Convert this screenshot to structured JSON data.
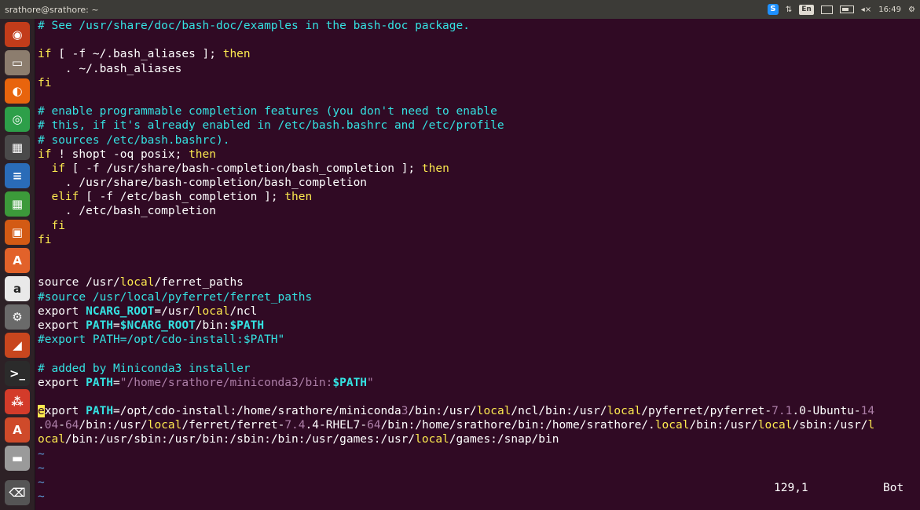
{
  "window": {
    "title": "srathore@srathore: ~"
  },
  "tray": {
    "skype": "S",
    "network": "⇅",
    "keyboard": "En",
    "volume": "◂×",
    "clock": "16:49",
    "settings": "⚙"
  },
  "launcher": [
    {
      "name": "ubuntu-dash-icon",
      "glyph": "◉",
      "bg": "#c23c1a"
    },
    {
      "name": "files-icon",
      "glyph": "▭",
      "bg": "#8c7d6e"
    },
    {
      "name": "firefox-icon",
      "glyph": "◐",
      "bg": "#e8640d"
    },
    {
      "name": "chrome-icon",
      "glyph": "◎",
      "bg": "#2d9f49"
    },
    {
      "name": "calculator-icon",
      "glyph": "▦",
      "bg": "#4a4a4a"
    },
    {
      "name": "libreoffice-writer-icon",
      "glyph": "≡",
      "bg": "#2a6cb8"
    },
    {
      "name": "libreoffice-calc-icon",
      "glyph": "▦",
      "bg": "#3c9a3a"
    },
    {
      "name": "libreoffice-impress-icon",
      "glyph": "▣",
      "bg": "#d35a14"
    },
    {
      "name": "software-center-icon",
      "glyph": "A",
      "bg": "#e2622a"
    },
    {
      "name": "amazon-icon",
      "glyph": "a",
      "bg": "#e9e9e9"
    },
    {
      "name": "system-settings-icon",
      "glyph": "⚙",
      "bg": "#6a6a6a"
    },
    {
      "name": "matlab-icon",
      "glyph": "◢",
      "bg": "#c8461e"
    },
    {
      "name": "terminal-icon",
      "glyph": ">_",
      "bg": "#2b2b2b"
    },
    {
      "name": "ubuntu-one-icon",
      "glyph": "⁂",
      "bg": "#d33b2a"
    },
    {
      "name": "software-updater-icon",
      "glyph": "A",
      "bg": "#cf4a2a"
    },
    {
      "name": "drive-icon",
      "glyph": "▬",
      "bg": "#9a9a9a"
    }
  ],
  "trash": {
    "glyph": "🗑",
    "bg": "#555"
  },
  "status": {
    "position": "129,1",
    "scroll": "Bot"
  },
  "lines": [
    [
      [
        "c",
        "# See /usr/share/doc/bash-doc/examples in the bash-doc package."
      ]
    ],
    [
      [
        "n",
        ""
      ]
    ],
    [
      [
        "k",
        "if"
      ],
      [
        "n",
        " [ -f ~/.bash_aliases ]; "
      ],
      [
        "k",
        "then"
      ]
    ],
    [
      [
        "n",
        "    . ~/.bash_aliases"
      ]
    ],
    [
      [
        "k",
        "fi"
      ]
    ],
    [
      [
        "n",
        ""
      ]
    ],
    [
      [
        "c",
        "# enable programmable completion features (you don't need to enable"
      ]
    ],
    [
      [
        "c",
        "# this, if it's already enabled in /etc/bash.bashrc and /etc/profile"
      ]
    ],
    [
      [
        "c",
        "# sources /etc/bash.bashrc)."
      ]
    ],
    [
      [
        "k",
        "if"
      ],
      [
        "n",
        " ! shopt -oq posix; "
      ],
      [
        "k",
        "then"
      ]
    ],
    [
      [
        "n",
        "  "
      ],
      [
        "k",
        "if"
      ],
      [
        "n",
        " [ -f /usr/share/bash-completion/bash_completion ]; "
      ],
      [
        "k",
        "then"
      ]
    ],
    [
      [
        "n",
        "    . /usr/share/bash-completion/bash_completion"
      ]
    ],
    [
      [
        "n",
        "  "
      ],
      [
        "k",
        "elif"
      ],
      [
        "n",
        " [ -f /etc/bash_completion ]; "
      ],
      [
        "k",
        "then"
      ]
    ],
    [
      [
        "n",
        "    . /etc/bash_completion"
      ]
    ],
    [
      [
        "n",
        "  "
      ],
      [
        "k",
        "fi"
      ]
    ],
    [
      [
        "k",
        "fi"
      ]
    ],
    [
      [
        "n",
        ""
      ]
    ],
    [
      [
        "n",
        ""
      ]
    ],
    [
      [
        "n",
        "source /usr/"
      ],
      [
        "l",
        "local"
      ],
      [
        "n",
        "/ferret_paths"
      ]
    ],
    [
      [
        "c",
        "#source /usr/local/pyferret/ferret_paths"
      ]
    ],
    [
      [
        "n",
        "export "
      ],
      [
        "v",
        "NCARG_ROOT"
      ],
      [
        "n",
        "="
      ],
      [
        "n",
        "/usr/"
      ],
      [
        "l",
        "local"
      ],
      [
        "n",
        "/ncl"
      ]
    ],
    [
      [
        "n",
        "export "
      ],
      [
        "v",
        "PATH"
      ],
      [
        "n",
        "="
      ],
      [
        "v",
        "$NCARG_ROOT"
      ],
      [
        "n",
        "/bin:"
      ],
      [
        "v",
        "$PATH"
      ]
    ],
    [
      [
        "c",
        "#export PATH=/opt/cdo-install:$PATH\""
      ]
    ],
    [
      [
        "n",
        ""
      ]
    ],
    [
      [
        "c",
        "# added by Miniconda3 installer"
      ]
    ],
    [
      [
        "n",
        "export "
      ],
      [
        "v",
        "PATH"
      ],
      [
        "n",
        "="
      ],
      [
        "s",
        "\"/home/srathore/miniconda3/bin:"
      ],
      [
        "v",
        "$PATH"
      ],
      [
        "s",
        "\""
      ]
    ],
    [
      [
        "n",
        ""
      ]
    ],
    [
      [
        "cur",
        "e"
      ],
      [
        "n",
        "xport "
      ],
      [
        "v",
        "PATH"
      ],
      [
        "n",
        "=/opt/cdo-install:/home/srathore/miniconda"
      ],
      [
        "m",
        "3"
      ],
      [
        "n",
        "/bin:/usr/"
      ],
      [
        "l",
        "local"
      ],
      [
        "n",
        "/ncl/bin:/usr/"
      ],
      [
        "l",
        "local"
      ],
      [
        "n",
        "/pyferret/pyferret-"
      ],
      [
        "m",
        "7.1"
      ],
      [
        "n",
        ".0-Ubuntu-"
      ],
      [
        "m",
        "14"
      ]
    ],
    [
      [
        "n",
        "."
      ],
      [
        "m",
        "04"
      ],
      [
        "n",
        "-"
      ],
      [
        "m",
        "64"
      ],
      [
        "n",
        "/bin:/usr/"
      ],
      [
        "l",
        "local"
      ],
      [
        "n",
        "/ferret/ferret-"
      ],
      [
        "m",
        "7.4"
      ],
      [
        "n",
        ".4-RHEL7-"
      ],
      [
        "m",
        "64"
      ],
      [
        "n",
        "/bin:/home/srathore/bin:/home/srathore/."
      ],
      [
        "l",
        "local"
      ],
      [
        "n",
        "/bin:/usr/"
      ],
      [
        "l",
        "local"
      ],
      [
        "n",
        "/sbin:/usr/"
      ],
      [
        "l",
        "l"
      ]
    ],
    [
      [
        "l",
        "ocal"
      ],
      [
        "n",
        "/bin:/usr/sbin:/usr/bin:/sbin:/bin:/usr/games:/usr/"
      ],
      [
        "l",
        "local"
      ],
      [
        "n",
        "/games:/snap/bin"
      ]
    ],
    [
      [
        "t",
        "~"
      ]
    ],
    [
      [
        "t",
        "~"
      ]
    ],
    [
      [
        "t",
        "~"
      ]
    ],
    [
      [
        "t",
        "~"
      ]
    ]
  ]
}
